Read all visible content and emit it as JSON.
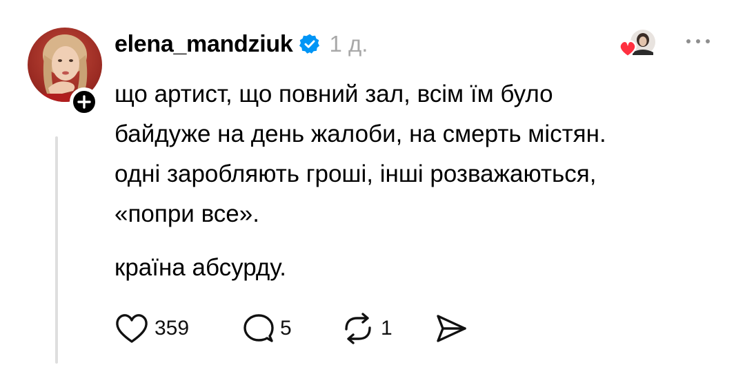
{
  "post": {
    "username": "elena_mandziuk",
    "timestamp": "1 д.",
    "paragraphs": [
      "що артист, що повний зал, всім їм було",
      "байдуже на день жалоби, на смерть містян.",
      "одні заробляють гроші, інші розважаються,",
      "«попри все».",
      "країна абсурду."
    ],
    "actions": {
      "likes": "359",
      "replies": "5",
      "reposts": "1"
    }
  },
  "icons": {
    "avatar": "profile-photo",
    "follow": "plus-icon",
    "verified": "verified-badge-icon",
    "liked_by": "liked-by-avatar-with-heart",
    "more": "more-dots-icon",
    "like": "heart-icon",
    "reply": "comment-bubble-icon",
    "repost": "repost-arrows-icon",
    "share": "send-icon"
  },
  "colors": {
    "verified_blue": "#0095f6",
    "timestamp_gray": "#a8a8a8",
    "heart_red": "#ff3040",
    "thread_line": "#dedede"
  }
}
